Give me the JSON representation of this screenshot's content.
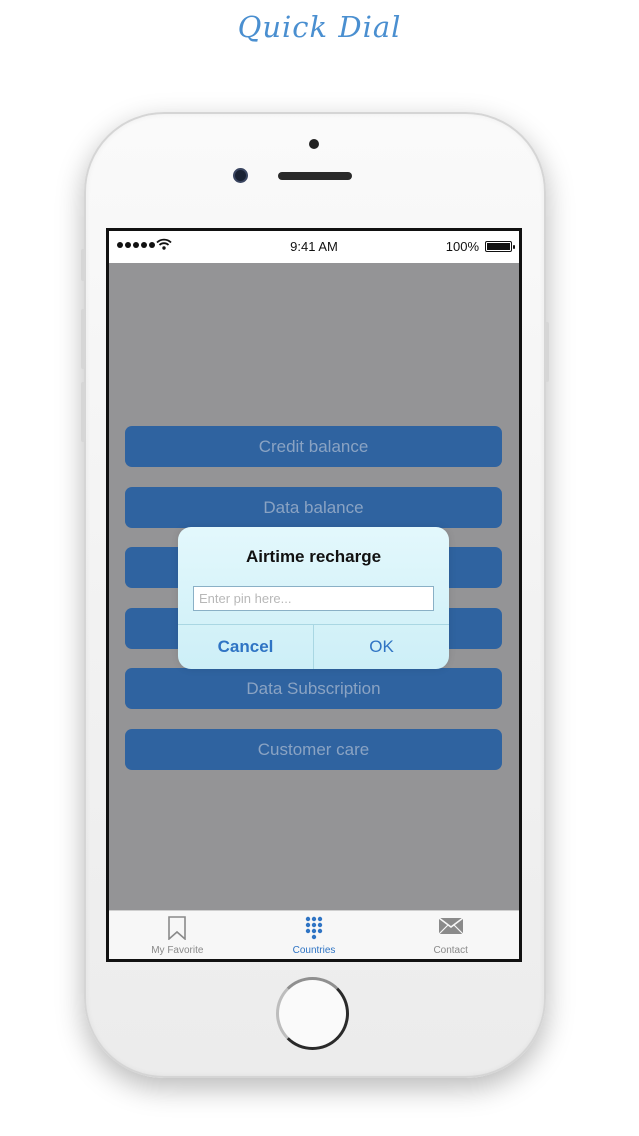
{
  "app_title": "Quick Dial",
  "status_bar": {
    "time": "9:41 AM",
    "battery_percent": "100%"
  },
  "menu": {
    "items": [
      {
        "label": "Credit balance"
      },
      {
        "label": "Data balance"
      },
      {
        "label": ""
      },
      {
        "label": ""
      },
      {
        "label": "Data Subscription"
      },
      {
        "label": "Customer care"
      }
    ]
  },
  "dialog": {
    "title": "Airtime recharge",
    "input_placeholder": "Enter pin here...",
    "input_value": "",
    "cancel_label": "Cancel",
    "ok_label": "OK"
  },
  "tab_bar": {
    "tabs": [
      {
        "label": "My Favorite",
        "icon": "bookmark-icon",
        "active": false
      },
      {
        "label": "Countries",
        "icon": "keypad-icon",
        "active": true
      },
      {
        "label": "Contact",
        "icon": "envelope-icon",
        "active": false
      }
    ]
  },
  "colors": {
    "accent": "#2f74c4",
    "menu_button": "#2f63a0",
    "overlay": "#949496",
    "title": "#4a8fd0"
  }
}
